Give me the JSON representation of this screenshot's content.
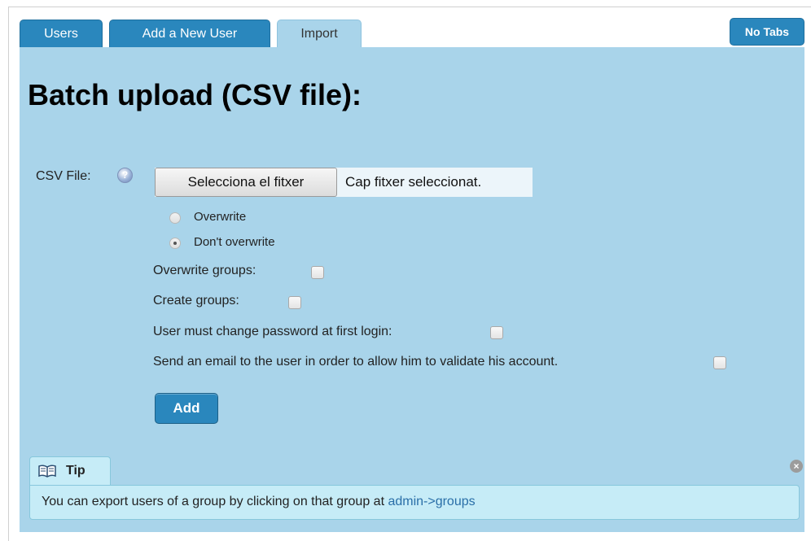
{
  "tabs": [
    {
      "label": "Users"
    },
    {
      "label": "Add a New User"
    },
    {
      "label": "Import"
    }
  ],
  "no_tabs_label": "No Tabs",
  "page_title": "Batch upload (CSV file):",
  "form": {
    "csv_label": "CSV File:",
    "file_button_label": "Selecciona el fitxer",
    "file_status": "Cap fitxer seleccionat.",
    "radio_overwrite": {
      "label": "Overwrite",
      "checked": false
    },
    "radio_dont_overwrite": {
      "label": "Don't overwrite",
      "checked": true
    },
    "overwrite_groups": {
      "label": "Overwrite groups:",
      "checked": false
    },
    "create_groups": {
      "label": "Create groups:",
      "checked": false
    },
    "change_password": {
      "label": "User must change password at first login:",
      "checked": false
    },
    "send_email": {
      "label": "Send an email to the user in order to allow him to validate his account.",
      "checked": false
    },
    "add_button_label": "Add"
  },
  "tip": {
    "title": "Tip",
    "text": "You can export users of a group by clicking on that group at ",
    "link_text": "admin->groups"
  },
  "icons": {
    "help": "question-icon",
    "tip": "book-icon",
    "close": "close-icon"
  },
  "colors": {
    "panel": "#a9d4ea",
    "tab_blue": "#2a87bd",
    "tip_bg": "#c6ecf7",
    "link": "#2a6fa8"
  }
}
